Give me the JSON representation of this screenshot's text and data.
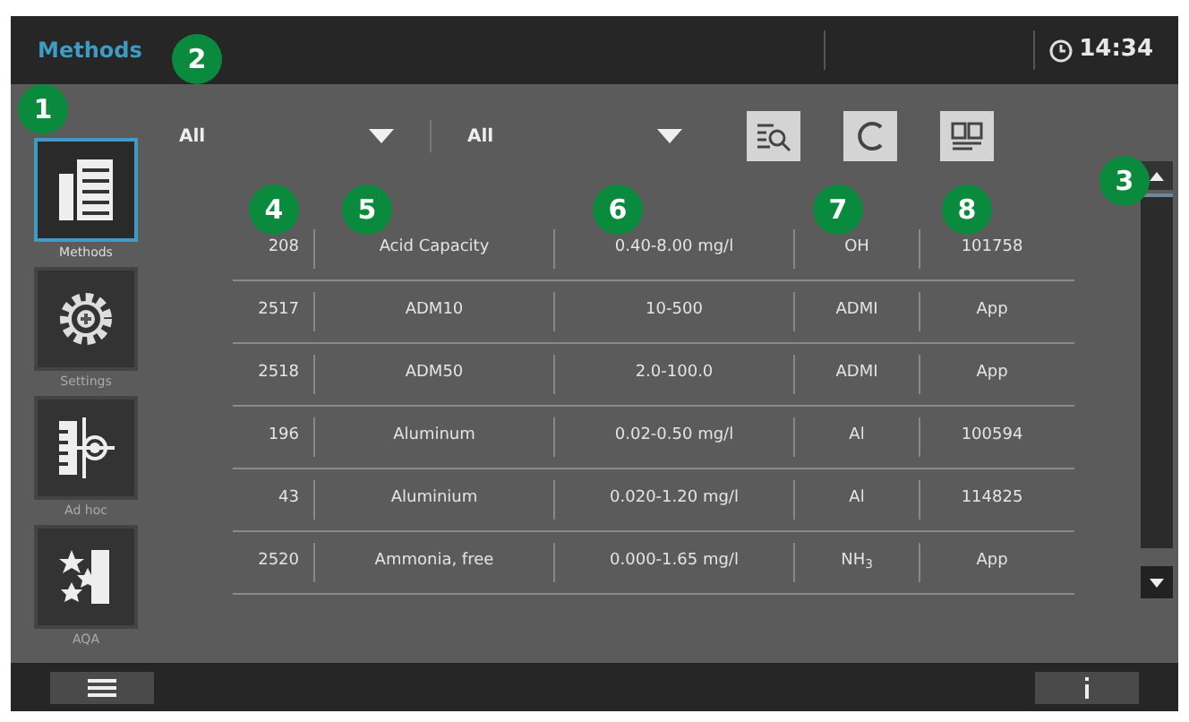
{
  "header": {
    "title": "Methods",
    "time": "14:34"
  },
  "sidebar": {
    "items": [
      {
        "label": "Methods",
        "selected": true
      },
      {
        "label": "Settings",
        "selected": false
      },
      {
        "label": "Ad hoc",
        "selected": false
      },
      {
        "label": "AQA",
        "selected": false
      }
    ]
  },
  "filters": [
    {
      "value": "All"
    },
    {
      "value": "All"
    }
  ],
  "table": {
    "rows": [
      [
        "208",
        "Acid Capacity",
        "0.40-8.00 mg/l",
        "OH",
        "101758"
      ],
      [
        "2517",
        "ADM10",
        "10-500",
        "ADMI",
        "App"
      ],
      [
        "2518",
        "ADM50",
        "2.0-100.0",
        "ADMI",
        "App"
      ],
      [
        "196",
        "Aluminum",
        "0.02-0.50 mg/l",
        "Al",
        "100594"
      ],
      [
        "43",
        "Aluminium",
        "0.020-1.20 mg/l",
        "Al",
        "114825"
      ],
      [
        "2520",
        "Ammonia, free",
        "0.000-1.65 mg/l",
        "NH$_{3}$",
        "App"
      ]
    ]
  },
  "callouts": [
    "1",
    "2",
    "3",
    "4",
    "5",
    "6",
    "7",
    "8"
  ]
}
